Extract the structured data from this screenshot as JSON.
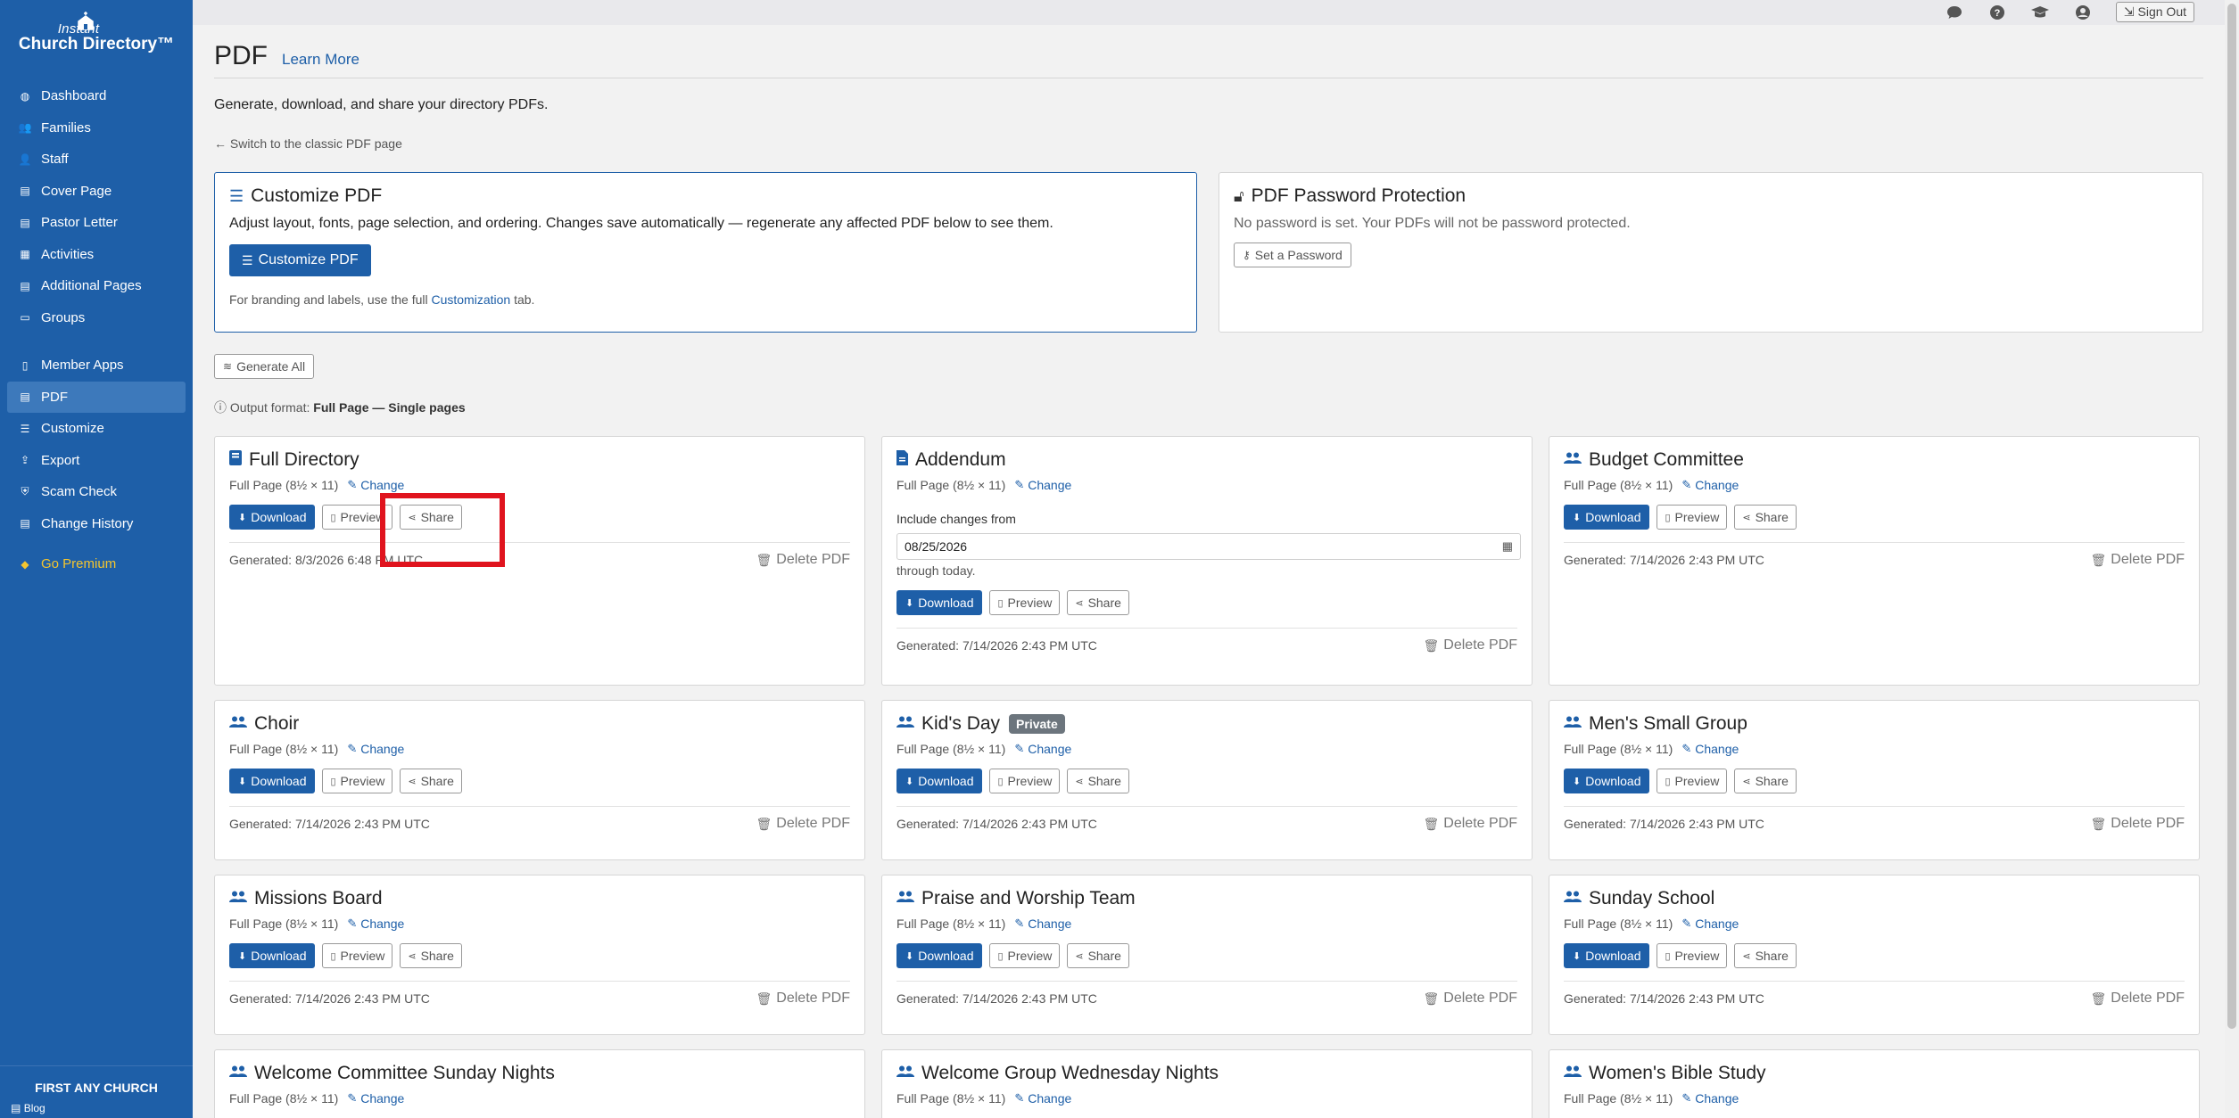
{
  "brand": {
    "line1": "Instant",
    "line2": "Church Directory™"
  },
  "nav": [
    {
      "label": "Dashboard",
      "icon": "dashboard-icon",
      "glyph": "◍"
    },
    {
      "label": "Families",
      "icon": "families-icon",
      "glyph": "👥"
    },
    {
      "label": "Staff",
      "icon": "staff-icon",
      "glyph": "👤"
    },
    {
      "label": "Cover Page",
      "icon": "cover-page-icon",
      "glyph": "▤"
    },
    {
      "label": "Pastor Letter",
      "icon": "pastor-letter-icon",
      "glyph": "▤"
    },
    {
      "label": "Activities",
      "icon": "activities-icon",
      "glyph": "▦"
    },
    {
      "label": "Additional Pages",
      "icon": "additional-pages-icon",
      "glyph": "▤"
    },
    {
      "label": "Groups",
      "icon": "groups-icon",
      "glyph": "▭"
    }
  ],
  "nav2": [
    {
      "label": "Member Apps",
      "icon": "member-apps-icon",
      "glyph": "▯"
    },
    {
      "label": "PDF",
      "icon": "pdf-icon",
      "glyph": "▤"
    },
    {
      "label": "Customize",
      "icon": "customize-icon",
      "glyph": "☰"
    },
    {
      "label": "Export",
      "icon": "export-icon",
      "glyph": "⇪"
    },
    {
      "label": "Scam Check",
      "icon": "shield-icon",
      "glyph": "⛨"
    },
    {
      "label": "Change History",
      "icon": "history-icon",
      "glyph": "▤"
    }
  ],
  "premium": "Go Premium",
  "church": "FIRST ANY CHURCH",
  "blog": "Blog",
  "topbar": {
    "signout": "Sign Out"
  },
  "page": {
    "title": "PDF",
    "learn_more": "Learn More",
    "intro": "Generate, download, and share your directory PDFs.",
    "classic": "Switch to the classic PDF page"
  },
  "customize_panel": {
    "title": "Customize PDF",
    "desc": "Adjust layout, fonts, page selection, and ordering. Changes save automatically — regenerate any affected PDF below to see them.",
    "button": "Customize PDF",
    "note_prefix": "For branding and labels, use the full ",
    "note_link": "Customization",
    "note_suffix": " tab."
  },
  "password_panel": {
    "title": "PDF Password Protection",
    "desc": "No password is set. Your PDFs will not be password protected.",
    "button": "Set a Password"
  },
  "generate_all": "Generate All",
  "output": {
    "prefix": "Output format: ",
    "value": "Full Page — Single pages"
  },
  "labels": {
    "format": "Full Page (8½ × 11)",
    "change": "Change",
    "download": "Download",
    "preview": "Preview",
    "share": "Share",
    "delete": "Delete PDF"
  },
  "addendum": {
    "include_from": "Include changes from",
    "date": "08/25/2026",
    "through": "through today."
  },
  "cards": [
    {
      "title": "Full Directory",
      "icon": "book-icon",
      "generated": "Generated: 8/3/2026 6:48 PM UTC"
    },
    {
      "title": "Addendum",
      "icon": "document-icon",
      "generated": "Generated: 7/14/2026 2:43 PM UTC"
    },
    {
      "title": "Budget Committee",
      "icon": "group-icon",
      "generated": "Generated: 7/14/2026 2:43 PM UTC"
    },
    {
      "title": "Choir",
      "icon": "group-icon",
      "generated": "Generated: 7/14/2026 2:43 PM UTC"
    },
    {
      "title": "Kid's Day",
      "icon": "group-icon",
      "badge": "Private",
      "generated": "Generated: 7/14/2026 2:43 PM UTC"
    },
    {
      "title": "Men's Small Group",
      "icon": "group-icon",
      "generated": "Generated: 7/14/2026 2:43 PM UTC"
    },
    {
      "title": "Missions Board",
      "icon": "group-icon",
      "generated": "Generated: 7/14/2026 2:43 PM UTC"
    },
    {
      "title": "Praise and Worship Team",
      "icon": "group-icon",
      "generated": "Generated: 7/14/2026 2:43 PM UTC"
    },
    {
      "title": "Sunday School",
      "icon": "group-icon",
      "generated": "Generated: 7/14/2026 2:43 PM UTC"
    },
    {
      "title": "Welcome Committee Sunday Nights",
      "icon": "group-icon"
    },
    {
      "title": "Welcome Group Wednesday Nights",
      "icon": "group-icon"
    },
    {
      "title": "Women's Bible Study",
      "icon": "group-icon"
    }
  ],
  "colors": {
    "sidebar": "#1e5fa8",
    "accent": "#1e5fa8",
    "highlight": "#e0141e",
    "premium": "#f3c52f"
  }
}
